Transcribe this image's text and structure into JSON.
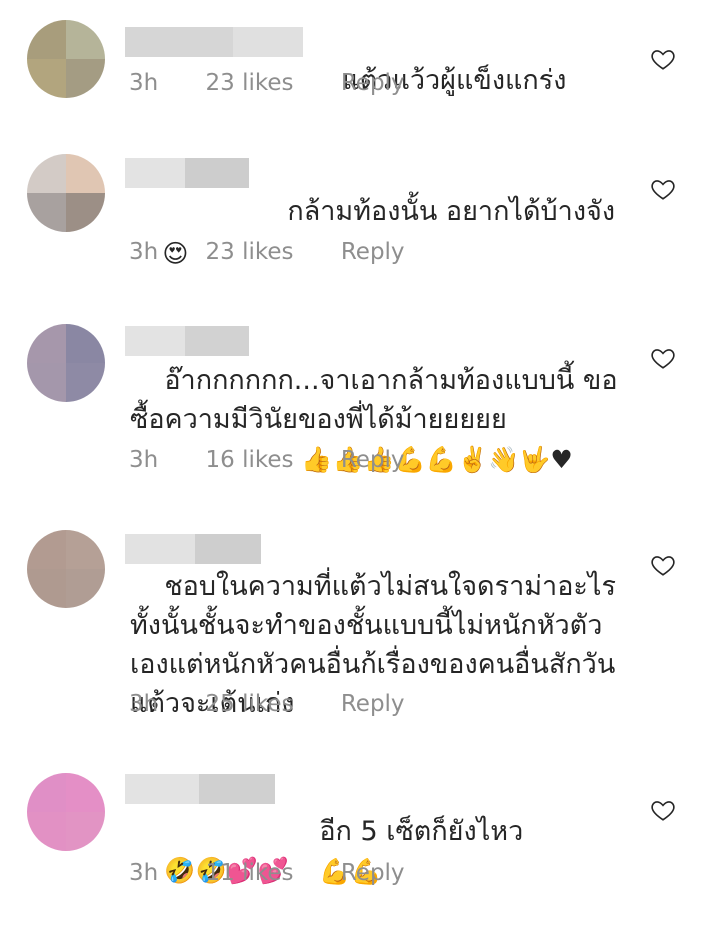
{
  "comments": [
    {
      "text": "แต้วแว้วผู้แข็งแกร่ง",
      "time": "3h",
      "likes": "23 likes",
      "reply": "Reply",
      "avatar_colors": [
        "#a89d7c",
        "#b5b499",
        "#b2a57e",
        "#a49c83"
      ]
    },
    {
      "text": "กล้ามท้องนั้น อยากได้บ้างจัง",
      "emoji": "😍",
      "time": "3h",
      "likes": "23 likes",
      "reply": "Reply",
      "avatar_colors": [
        "#d3cbc6",
        "#e0c6b3",
        "#a8a19f",
        "#9c8f86"
      ]
    },
    {
      "text": "อ๊ากกกกกก...จาเอากล้ามท้องแบบนี้ ขอซื้อความมีวินัยของพี่ได้ม้ายยยยย",
      "emoji": "👍👍👍💪💪✌️👋🤟♥",
      "time": "3h",
      "likes": "16 likes",
      "reply": "Reply",
      "avatar_colors": [
        "#a697ab",
        "#8a87a3",
        "#a497ab",
        "#8e8aa5"
      ]
    },
    {
      "text": "ชอบในความที่แต้วไม่สนใจดราม่าอะไรทั้งนั้นชั้นจะทำของชั้นแบบนี้ไม่หนักหัวตัวเองแต่หนักหัวคนอื่นก้เรื่องของคนอื่นสักวันแต้วจะเต้นเก่ง",
      "time": "3h",
      "likes": "25 likes",
      "reply": "Reply",
      "avatar_colors": [
        "#b29b91",
        "#b5a096",
        "#af9a90",
        "#b09d94"
      ]
    },
    {
      "text": "อีก 5 เซ็ตก็ยังไหว",
      "emoji": "💪💪",
      "emoji2": "🤣🤣💕💕",
      "time": "3h",
      "likes": "11 likes",
      "reply": "Reply",
      "avatar_colors": [
        "#e08fc6",
        "#e48fc6",
        "#e291c4",
        "#e294c4"
      ]
    }
  ]
}
